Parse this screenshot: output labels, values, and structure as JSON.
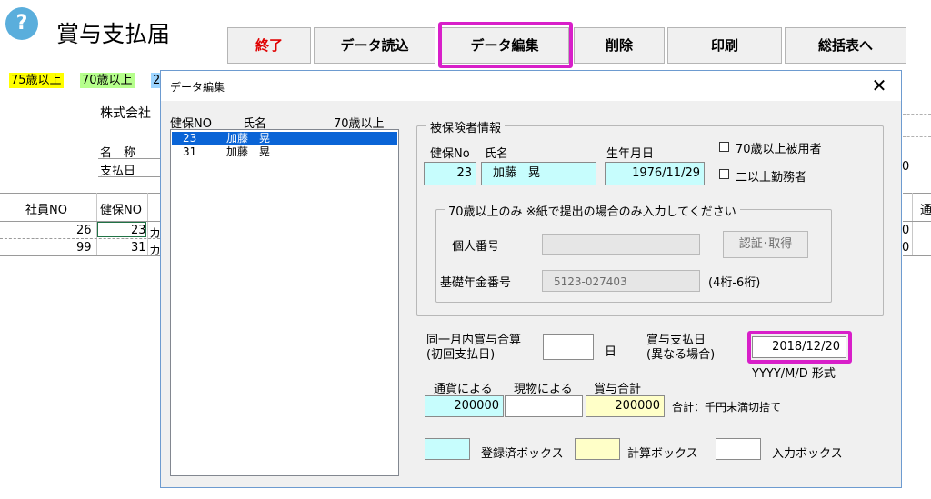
{
  "app": {
    "help_icon": "?",
    "title": "賞与支払届",
    "toolbar": [
      "終了",
      "データ読込",
      "データ編集",
      "削除",
      "印刷",
      "総括表へ"
    ],
    "tags": [
      {
        "label": "75歳以上",
        "color": "#ffff00"
      },
      {
        "label": "70歳以上",
        "color": "#b6ff8c"
      },
      {
        "label": "2",
        "color": "#9cd4ff"
      }
    ],
    "company_partial": "株式会社",
    "name_label": "名　称",
    "paydate_label": "支払日",
    "right_zero": "0",
    "table_headers": [
      "社員NO",
      "健保NO"
    ],
    "table_rows": [
      {
        "emp_no": "26",
        "kenpo_no": "23",
        "name_partial": "カ",
        "right": "0"
      },
      {
        "emp_no": "99",
        "kenpo_no": "31",
        "name_partial": "カ",
        "right": "0"
      }
    ],
    "right_header_partial": "通"
  },
  "dialog": {
    "title": "データ編集",
    "close": "✕",
    "list_headers": {
      "no": "健保NO",
      "name": "氏名",
      "over70": "70歳以上"
    },
    "list_items": [
      {
        "no": "23",
        "name": "加藤　晃",
        "selected": true
      },
      {
        "no": "31",
        "name": "加藤　晃",
        "selected": false
      }
    ],
    "insured_group": "被保険者情報",
    "labels": {
      "kenpo": "健保No",
      "name": "氏名",
      "birth": "生年月日"
    },
    "values": {
      "kenpo": "23",
      "name": "加藤　晃",
      "birth": "1976/11/29"
    },
    "checkboxes": [
      "70歳以上被用者",
      "二以上勤務者"
    ],
    "over70_group": "70歳以上のみ ※紙で提出の場合のみ入力してください",
    "my_number_label": "個人番号",
    "my_number_value": "",
    "auth_button": "認証･取得",
    "pension_label": "基礎年金番号",
    "pension_value": "5123-027403",
    "pension_hint": "(4桁-6桁)",
    "same_month_label_1": "同一月内賞与合算",
    "same_month_label_2": "(初回支払日)",
    "same_month_value": "",
    "day_suffix": "日",
    "pay_date_label_1": "賞与支払日",
    "pay_date_label_2": "(異なる場合)",
    "pay_date_value": "2018/12/20",
    "pay_date_format": "YYYY/M/D 形式",
    "amount_headers": {
      "currency": "通貨による",
      "goods": "現物による",
      "total": "賞与合計"
    },
    "amounts": {
      "currency": "200000",
      "goods": "",
      "total": "200000"
    },
    "amount_note": "合計：千円未満切捨て",
    "legend": {
      "registered": "登録済ボックス",
      "calc": "計算ボックス",
      "input": "入力ボックス"
    }
  },
  "colors": {
    "highlight": "#d81fc9",
    "cyan": "#c7fdfd",
    "yellow": "#ffffc8",
    "selection": "#0a64d6"
  }
}
